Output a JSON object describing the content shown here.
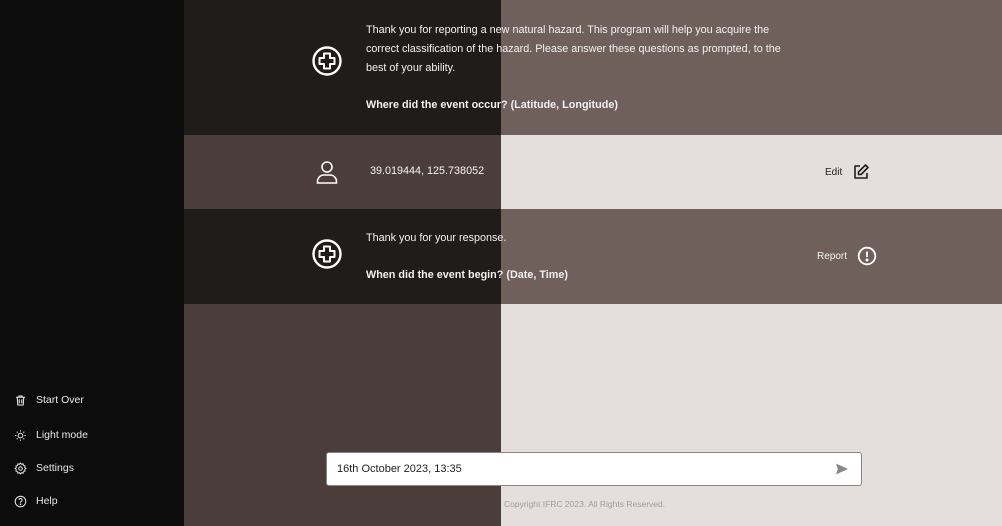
{
  "sidebar": {
    "items": [
      {
        "label": "Start Over",
        "icon": "trash-icon"
      },
      {
        "label": "Light mode",
        "icon": "sun-icon"
      },
      {
        "label": "Settings",
        "icon": "gear-icon"
      },
      {
        "label": "Help",
        "icon": "help-circle-icon"
      }
    ]
  },
  "conversation": {
    "bot_message_1": {
      "text": "Thank you for reporting a new natural hazard. This program will help you acquire the correct classification of the hazard. Please answer these questions as prompted, to the best of your ability.",
      "question": "Where did the event occur? (Latitude, Longitude)",
      "icon": "plus-circle-icon"
    },
    "user_message_1": {
      "text": "39.019444, 125.738052",
      "icon": "user-icon",
      "action_label": "Edit",
      "action_icon": "edit-icon"
    },
    "bot_message_2": {
      "text": "Thank you for your response.",
      "question": "When did the event begin? (Date, Time)",
      "icon": "plus-circle-icon",
      "action_label": "Report",
      "action_icon": "alert-circle-icon"
    }
  },
  "composer": {
    "value": "16th October 2023, 13:35",
    "send_icon": "send-icon"
  },
  "footer": {
    "copyright": "Copyright IFRC 2023. All Rights Reserved."
  },
  "colors": {
    "sidebar_bg": "#0d0c0c",
    "bot_row_dark": "#201c1b",
    "bot_row_light": "#6f605c",
    "user_row_dark": "#4a3d3a",
    "user_row_light": "#e4dfdd"
  }
}
